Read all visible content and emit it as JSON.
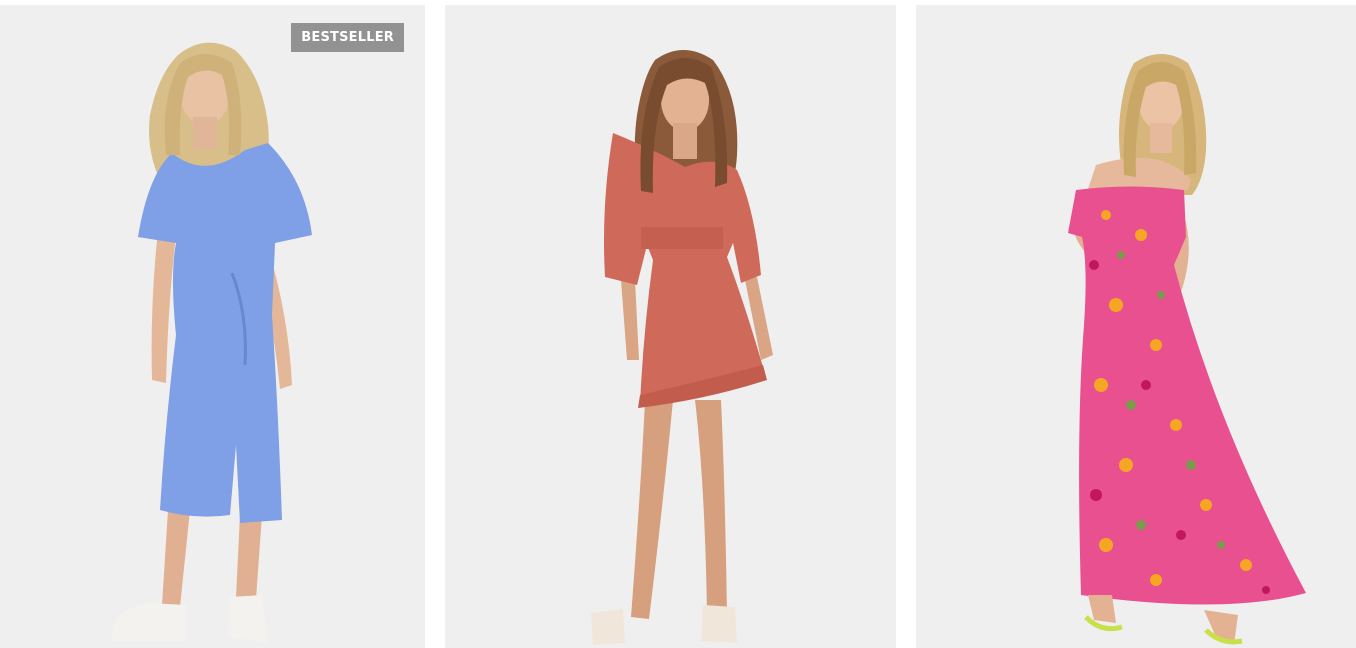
{
  "products": [
    {
      "badge": "BESTSELLER",
      "image": {
        "subject": "model-in-blue-midi-dress",
        "dress_color": "#7f9fe6"
      }
    },
    {
      "badge": "",
      "image": {
        "subject": "model-in-terracotta-mini-dress",
        "dress_color": "#cf6a5a"
      }
    },
    {
      "badge": "",
      "image": {
        "subject": "model-in-pink-floral-maxi-dress",
        "dress_color": "#e8508f"
      }
    }
  ],
  "colors": {
    "card_background": "#efeff0",
    "badge_background": "#929292",
    "badge_text": "#ffffff"
  }
}
